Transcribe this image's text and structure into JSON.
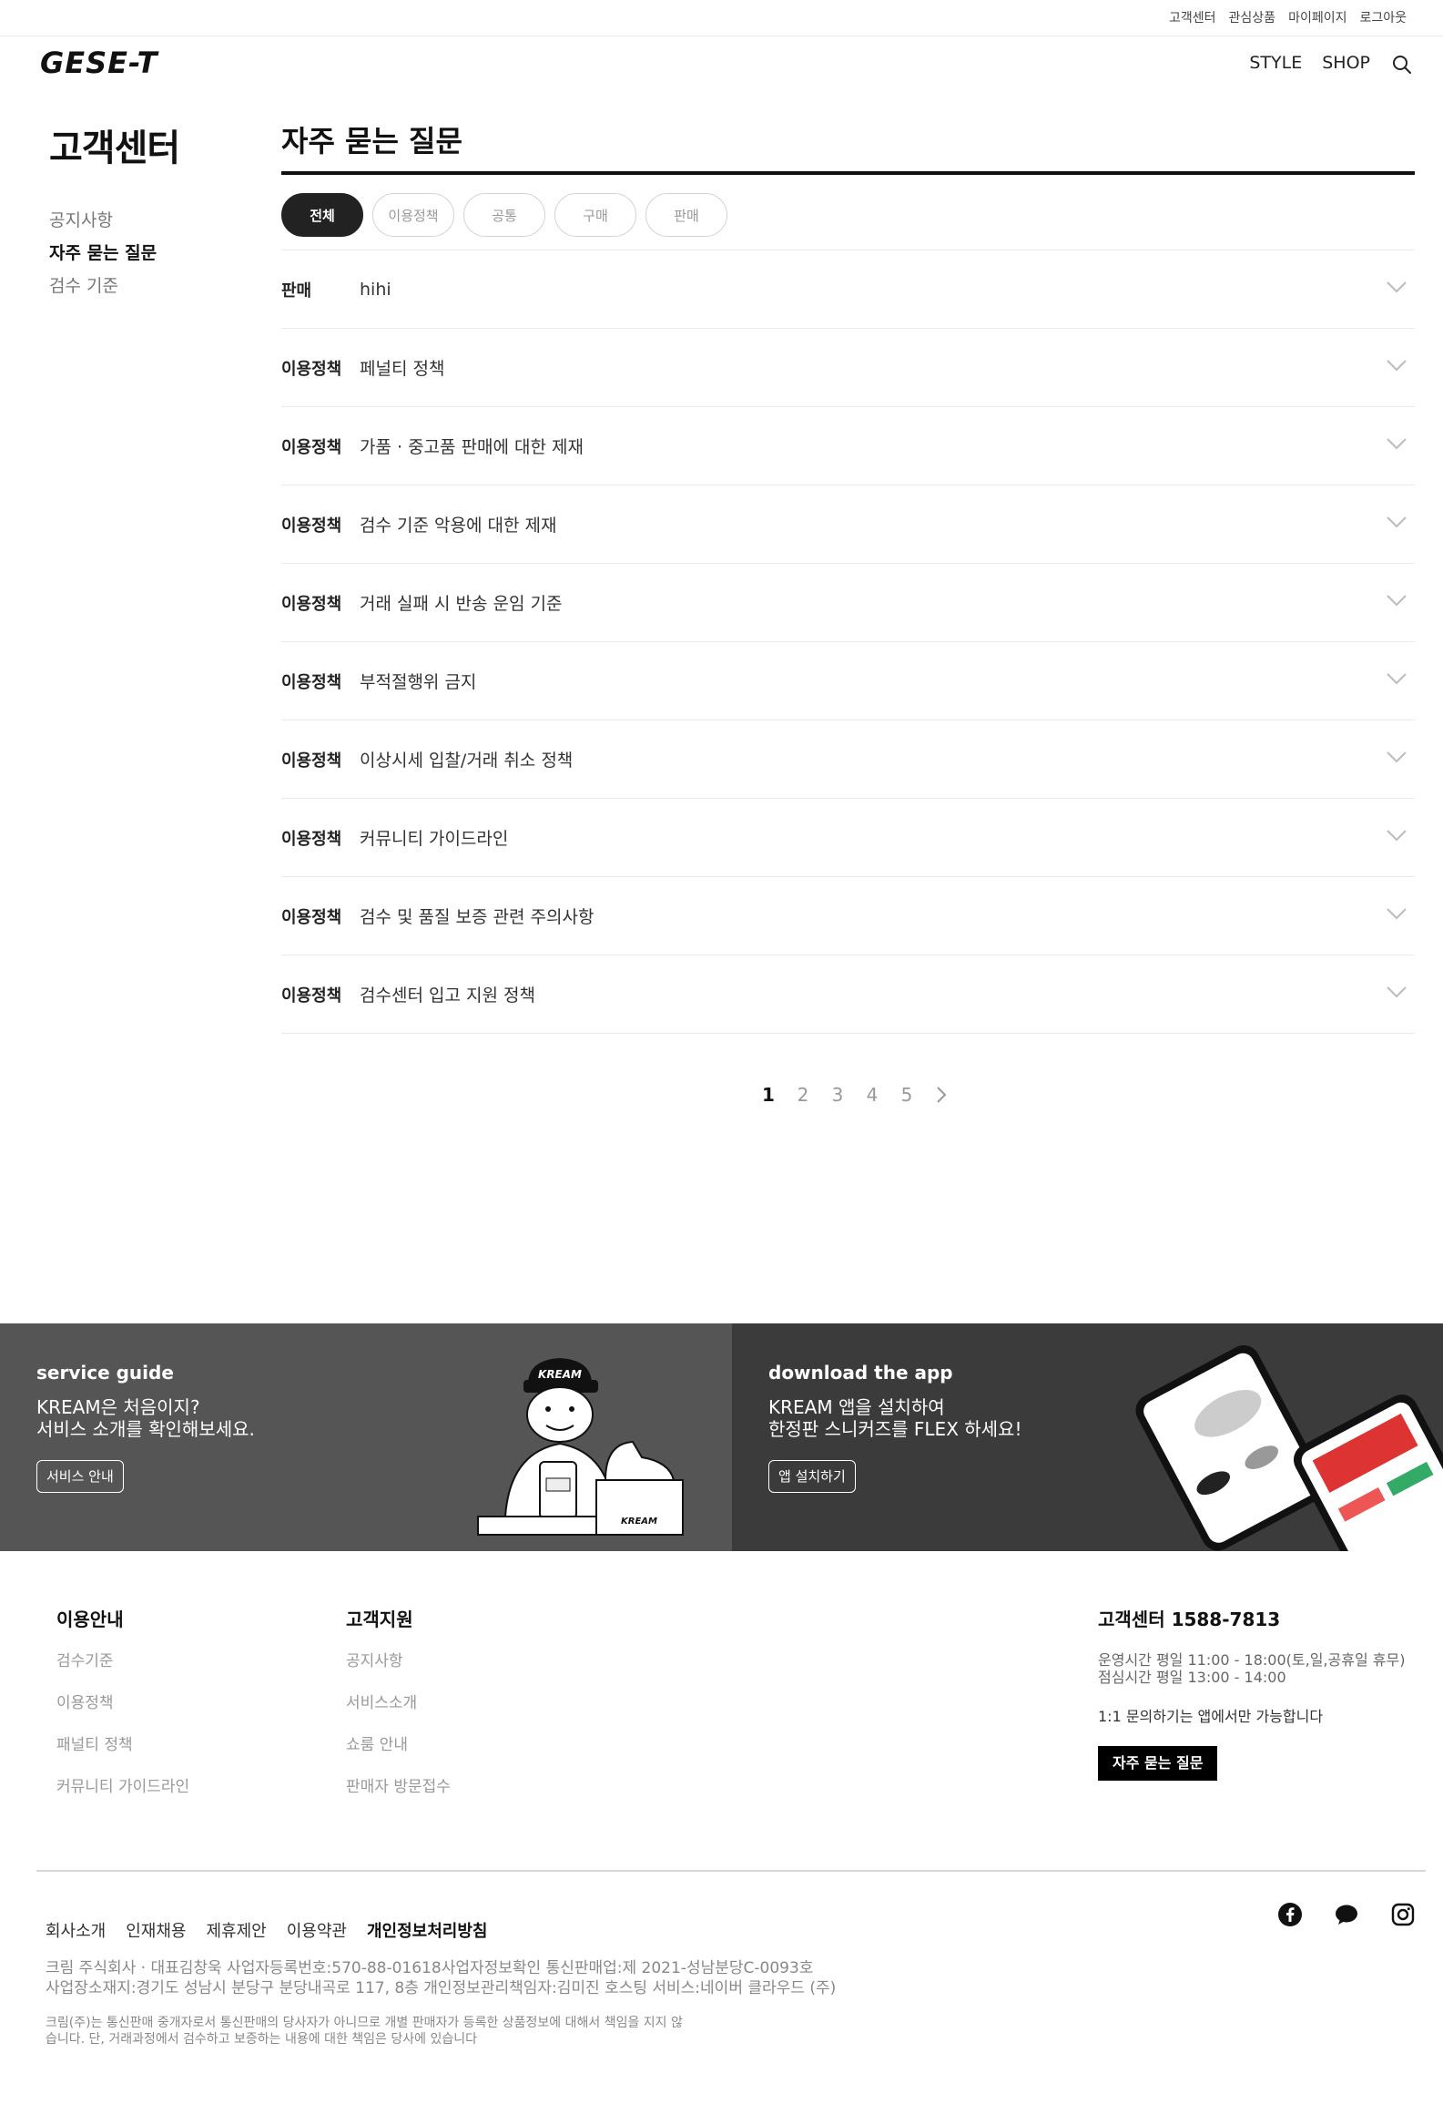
{
  "topbar": {
    "links": [
      "고객센터",
      "관심상품",
      "마이페이지",
      "로그아웃"
    ]
  },
  "header": {
    "logo": "GESE-T",
    "nav": [
      "STYLE",
      "SHOP"
    ]
  },
  "sidebar": {
    "title": "고객센터",
    "items": [
      {
        "label": "공지사항",
        "active": false
      },
      {
        "label": "자주 묻는 질문",
        "active": true
      },
      {
        "label": "검수 기준",
        "active": false
      }
    ]
  },
  "main": {
    "title": "자주 묻는 질문",
    "chips": [
      "전체",
      "이용정책",
      "공통",
      "구매",
      "판매"
    ],
    "active_chip": "전체",
    "faqs": [
      {
        "category": "판매",
        "question": "hihi"
      },
      {
        "category": "이용정책",
        "question": "페널티 정책"
      },
      {
        "category": "이용정책",
        "question": "가품 · 중고품 판매에 대한 제재"
      },
      {
        "category": "이용정책",
        "question": "검수 기준 악용에 대한 제재"
      },
      {
        "category": "이용정책",
        "question": "거래 실패 시 반송 운임 기준"
      },
      {
        "category": "이용정책",
        "question": "부적절행위 금지"
      },
      {
        "category": "이용정책",
        "question": "이상시세 입찰/거래 취소 정책"
      },
      {
        "category": "이용정책",
        "question": "커뮤니티 가이드라인"
      },
      {
        "category": "이용정책",
        "question": "검수 및 품질 보증 관련 주의사항"
      },
      {
        "category": "이용정책",
        "question": "검수센터 입고 지원 정책"
      }
    ],
    "pagination": {
      "pages": [
        "1",
        "2",
        "3",
        "4",
        "5"
      ],
      "current": "1"
    }
  },
  "banners": {
    "service": {
      "title": "service guide",
      "line1": "KREAM은 처음이지?",
      "line2": "서비스 소개를 확인해보세요.",
      "button": "서비스 안내",
      "cap_text": "KREAM",
      "box_text": "KREAM"
    },
    "app": {
      "title": "download the app",
      "line1": "KREAM 앱을 설치하여",
      "line2": "한정판 스니커즈를 FLEX 하세요!",
      "button": "앱 설치하기"
    }
  },
  "footer": {
    "guide": {
      "title": "이용안내",
      "items": [
        "검수기준",
        "이용정책",
        "패널티 정책",
        "커뮤니티 가이드라인"
      ]
    },
    "support": {
      "title": "고객지원",
      "items": [
        "공지사항",
        "서비스소개",
        "쇼룸 안내",
        "판매자 방문접수"
      ]
    },
    "cs": {
      "title": "고객센터 1588-7813",
      "hours1": "운영시간 평일 11:00 - 18:00(토,일,공휴일 휴무)",
      "hours2": "점심시간 평일 13:00 - 14:00",
      "note": "1:1 문의하기는 앱에서만 가능합니다",
      "button": "자주 묻는 질문"
    },
    "legal_links": [
      "회사소개",
      "인재채용",
      "제휴제안",
      "이용약관",
      "개인정보처리방침"
    ],
    "biz_line1": "크림 주식회사 · 대표김창욱    사업자등록번호:570-88-01618사업자정보확인    통신판매업:제 2021-성남분당C-0093호",
    "biz_line2": "사업장소재지:경기도 성남시 분당구 분당내곡로 117, 8층    개인정보관리책임자:김미진    호스팅 서비스:네이버 클라우드 (주)",
    "disclaimer1": "크림(주)는 통신판매 중개자로서 통신판매의 당사자가 아니므로 개별 판매자가 등록한 상품정보에 대해서 책임을 지지 않",
    "disclaimer2": "습니다. 단, 거래과정에서 검수하고 보증하는 내용에 대한 책임은 당사에 있습니다"
  },
  "colors": {
    "dark": "#222222",
    "banner_left": "#555555",
    "banner_right": "#3b3b3b"
  },
  "icons": [
    "search-icon",
    "chevron-down-icon",
    "chevron-right-icon",
    "facebook-icon",
    "talk-icon",
    "instagram-icon"
  ]
}
